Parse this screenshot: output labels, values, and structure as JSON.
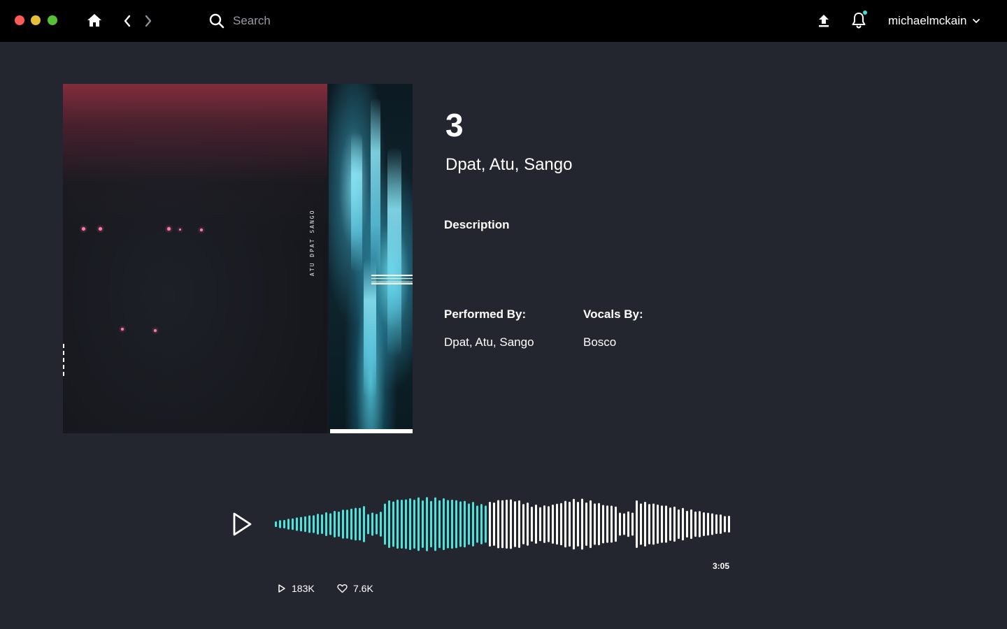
{
  "window": {
    "traffic_lights": [
      "#fc5b57",
      "#e5bf3c",
      "#57c038"
    ]
  },
  "header": {
    "search_placeholder": "Search",
    "username": "michaelmckain",
    "notification_dot_color": "#3de0d8",
    "icons": [
      "home-icon",
      "chevron-left-icon",
      "chevron-right-icon",
      "search-icon",
      "upload-icon",
      "bell-icon",
      "chevron-down-icon"
    ]
  },
  "artwork": {
    "spine_text": "ATU DPAT SANGO"
  },
  "track": {
    "title": "3",
    "artists": "Dpat, Atu, Sango",
    "description_label": "Description",
    "performed_by_label": "Performed By:",
    "performed_by_value": "Dpat, Atu, Sango",
    "vocals_by_label": "Vocals By:",
    "vocals_by_value": "Bosco"
  },
  "player": {
    "duration": "3:05",
    "progress": 0.47,
    "played_color": "#4de3db",
    "unplayed_color": "#ffffff",
    "plays": "183K",
    "likes": "7.6K"
  }
}
